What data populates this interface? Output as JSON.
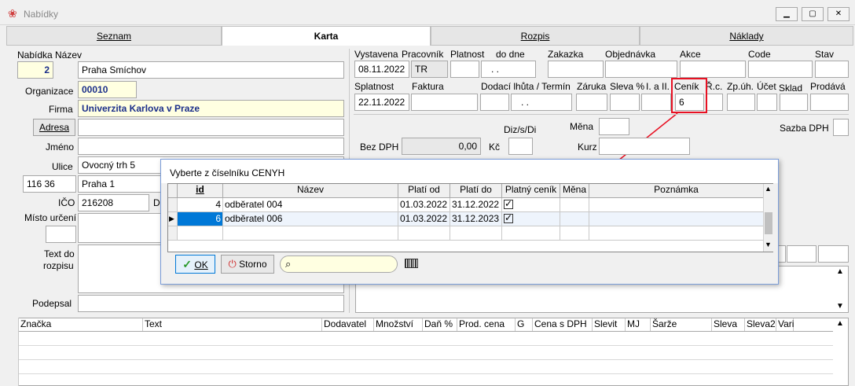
{
  "window": {
    "title": "Nabídky"
  },
  "tabs": [
    "Seznam",
    "Karta",
    "Rozpis",
    "Náklady"
  ],
  "left": {
    "nabidka_label": "Nabídka",
    "nazev_label": "Název",
    "nabidka_value": "2",
    "nazev_value": "Praha Smíchov",
    "organizace_label": "Organizace",
    "organizace_value": "00010",
    "firma_label": "Firma",
    "firma_value": "Univerzita Karlova v Praze",
    "adresa_button": "Adresa",
    "jmeno_label": "Jméno",
    "ulice_label": "Ulice",
    "ulice_value": "Ovocný trh 5",
    "psc_value": "116 36",
    "mesto_value": "Praha 1",
    "ico_label": "IČO",
    "ico_value": "216208",
    "dic_label": "D",
    "misto_label": "Místo určení",
    "text_label_1": "Text do",
    "text_label_2": "rozpisu",
    "podepsal_label": "Podepsal"
  },
  "right": {
    "vystavena_label": "Vystavena",
    "vystavena_value": "08.11.2022",
    "pracovnik_label": "Pracovník",
    "pracovnik_value": "TR",
    "platnost_label": "Platnost",
    "do_dne_label": "do dne",
    "do_dne_value": ". .",
    "zakazka_label": "Zakazka",
    "objednavka_label": "Objednávka",
    "akce_label": "Akce",
    "code_label": "Code",
    "stav_label": "Stav",
    "splatnost_label": "Splatnost",
    "splatnost_value": "22.11.2022",
    "faktura_label": "Faktura",
    "dodaci_label": "Dodací lhůta / Termín",
    "dodaci_value": ". .",
    "zaruka_label": "Záruka",
    "sleva_label": "Sleva %",
    "l_a_ll_label": "I. a II.",
    "cenik_label": "Ceník",
    "cenik_value": "6",
    "rc_label": "Ř.c.",
    "zpuh_label": "Zp.úh.",
    "ucet_label": "Účet",
    "sklad_label": "Sklad",
    "prodava_label": "Prodává",
    "diz_label": "Diz/s/Di",
    "mena_label": "Měna",
    "sazba_label": "Sazba DPH",
    "bez_dph_label": "Bez DPH",
    "bez_dph_value": "0,00",
    "kc_label": "Kč",
    "kurz_label": "Kurz"
  },
  "dialog": {
    "title": "Vyberte z číselníku CENYH",
    "columns": [
      "id",
      "Název",
      "Platí od",
      "Platí do",
      "Platný ceník",
      "Měna",
      "Poznámka"
    ],
    "rows": [
      {
        "id": "4",
        "nazev": "odběratel 004",
        "od": "01.03.2022",
        "do": "31.12.2022",
        "platny": true
      },
      {
        "id": "6",
        "nazev": "odběratel 006",
        "od": "01.03.2022",
        "do": "31.12.2023",
        "platny": true
      }
    ],
    "ok_label": "OK",
    "storno_label": "Storno",
    "search_placeholder": ""
  },
  "bottom_columns": [
    "Značka",
    "Text",
    "Dodavatel",
    "Množství",
    "Daň %",
    "Prod. cena",
    "G",
    "Cena s DPH",
    "Slevit",
    "MJ",
    "Šarže",
    "Sleva",
    "Sleva2",
    "Vari"
  ],
  "colors": {
    "highlight": "#e81123",
    "selection": "#0078d7",
    "yellow_field": "#ffffe1"
  }
}
